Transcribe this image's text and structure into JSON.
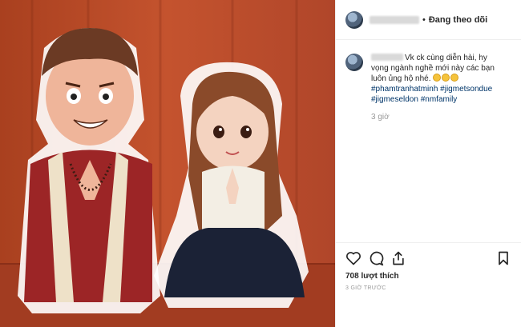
{
  "header": {
    "follow_label": "Đang theo dõi",
    "separator": "•"
  },
  "caption": {
    "text": "Vk ck cùng diễn hài, hy vọng ngành nghề mới này các bạn luôn ủng hộ nhé.",
    "tags": [
      "#phamtranhatminh",
      "#jigmetsondue",
      "#jigmeseldon",
      "#nmfamily"
    ],
    "time": "3 giờ"
  },
  "actions": {
    "icons": [
      "heart-icon",
      "comment-icon",
      "share-icon",
      "bookmark-icon"
    ]
  },
  "likes_text": "708 lượt thích",
  "posted_ago": "3 GIỜ TRƯỚC",
  "colors": {
    "background_red": "#b5482c",
    "hashtag": "#003569",
    "muted": "#999999"
  }
}
